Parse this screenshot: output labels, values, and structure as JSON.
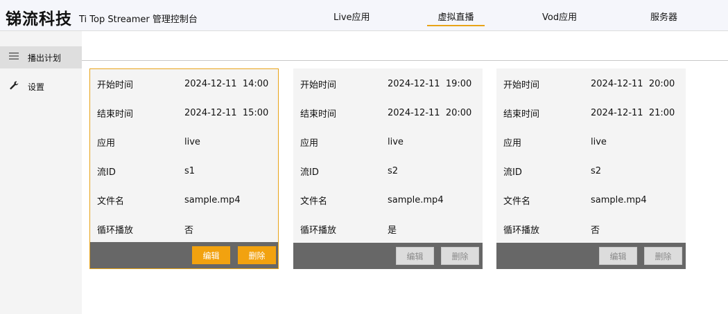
{
  "header": {
    "brand": "锑流科技",
    "subtitle": "Ti Top Streamer 管理控制台",
    "nav": [
      {
        "label": "Live应用"
      },
      {
        "label": "虚拟直播",
        "active": true
      },
      {
        "label": "Vod应用"
      },
      {
        "label": "服务器"
      }
    ],
    "accent_color": "#e8a317"
  },
  "sidebar": {
    "items": [
      {
        "label": "播出计划",
        "icon": "menu-icon",
        "active": true
      },
      {
        "label": "设置",
        "icon": "wrench-icon"
      }
    ]
  },
  "cards": [
    {
      "fields": [
        {
          "key": "开始时间",
          "value": "2024-12-11  14:00"
        },
        {
          "key": "结束时间",
          "value": "2024-12-11  15:00"
        },
        {
          "key": "应用",
          "value": "live"
        },
        {
          "key": "流ID",
          "value": "s1"
        },
        {
          "key": "文件名",
          "value": "sample.mp4"
        },
        {
          "key": "循环播放",
          "value": "否"
        }
      ],
      "edit_label": "编辑",
      "delete_label": "删除",
      "selected": true
    },
    {
      "fields": [
        {
          "key": "开始时间",
          "value": "2024-12-11  19:00"
        },
        {
          "key": "结束时间",
          "value": "2024-12-11  20:00"
        },
        {
          "key": "应用",
          "value": "live"
        },
        {
          "key": "流ID",
          "value": "s2"
        },
        {
          "key": "文件名",
          "value": "sample.mp4"
        },
        {
          "key": "循环播放",
          "value": "是"
        }
      ],
      "edit_label": "编辑",
      "delete_label": "删除",
      "selected": false
    },
    {
      "fields": [
        {
          "key": "开始时间",
          "value": "2024-12-11  20:00"
        },
        {
          "key": "结束时间",
          "value": "2024-12-11  21:00"
        },
        {
          "key": "应用",
          "value": "live"
        },
        {
          "key": "流ID",
          "value": "s2"
        },
        {
          "key": "文件名",
          "value": "sample.mp4"
        },
        {
          "key": "循环播放",
          "value": "否"
        }
      ],
      "edit_label": "编辑",
      "delete_label": "删除",
      "selected": false
    }
  ]
}
